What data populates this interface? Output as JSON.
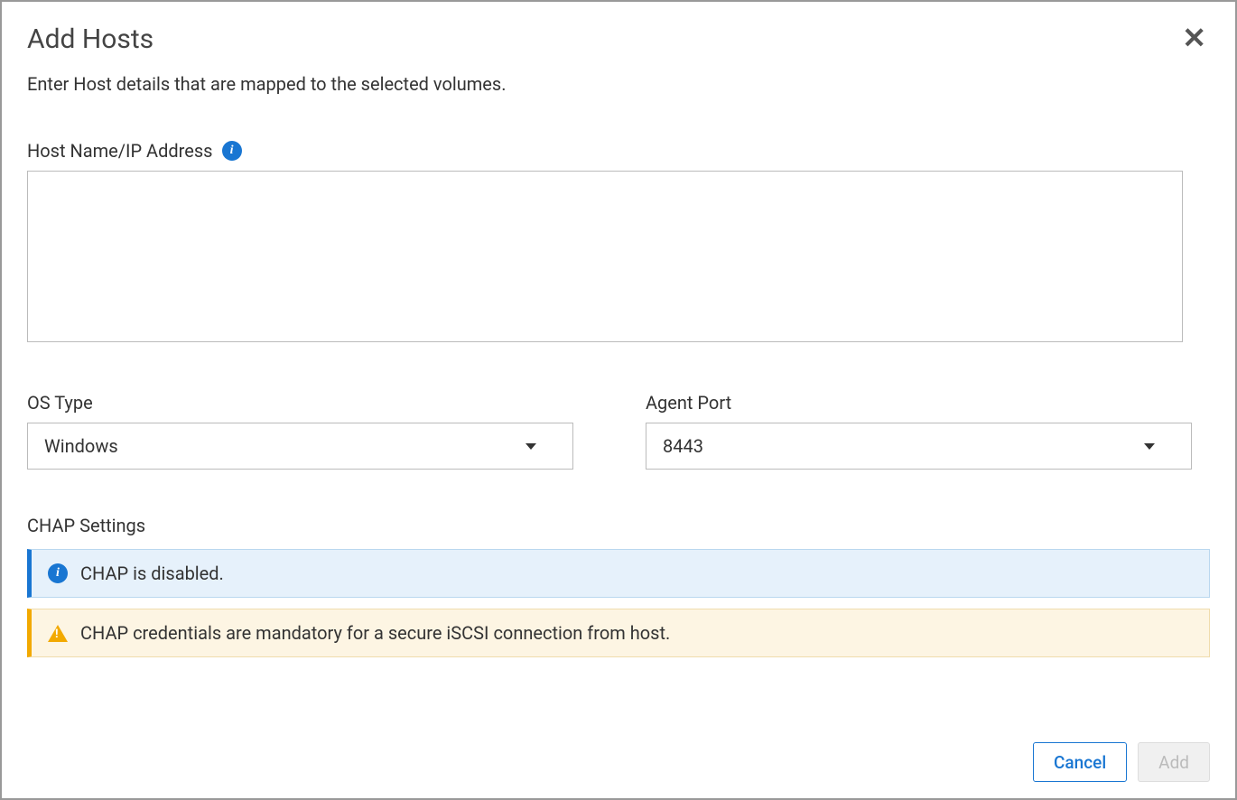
{
  "modal": {
    "title": "Add Hosts",
    "subtitle": "Enter Host details that are mapped to the selected volumes."
  },
  "fields": {
    "host_label": "Host Name/IP Address",
    "host_value": "",
    "os_type_label": "OS Type",
    "os_type_value": "Windows",
    "agent_port_label": "Agent Port",
    "agent_port_value": "8443"
  },
  "chap": {
    "section_title": "CHAP Settings",
    "info_message": "CHAP is disabled.",
    "warning_message": "CHAP credentials are mandatory for a secure iSCSI connection from host."
  },
  "buttons": {
    "cancel": "Cancel",
    "add": "Add"
  }
}
